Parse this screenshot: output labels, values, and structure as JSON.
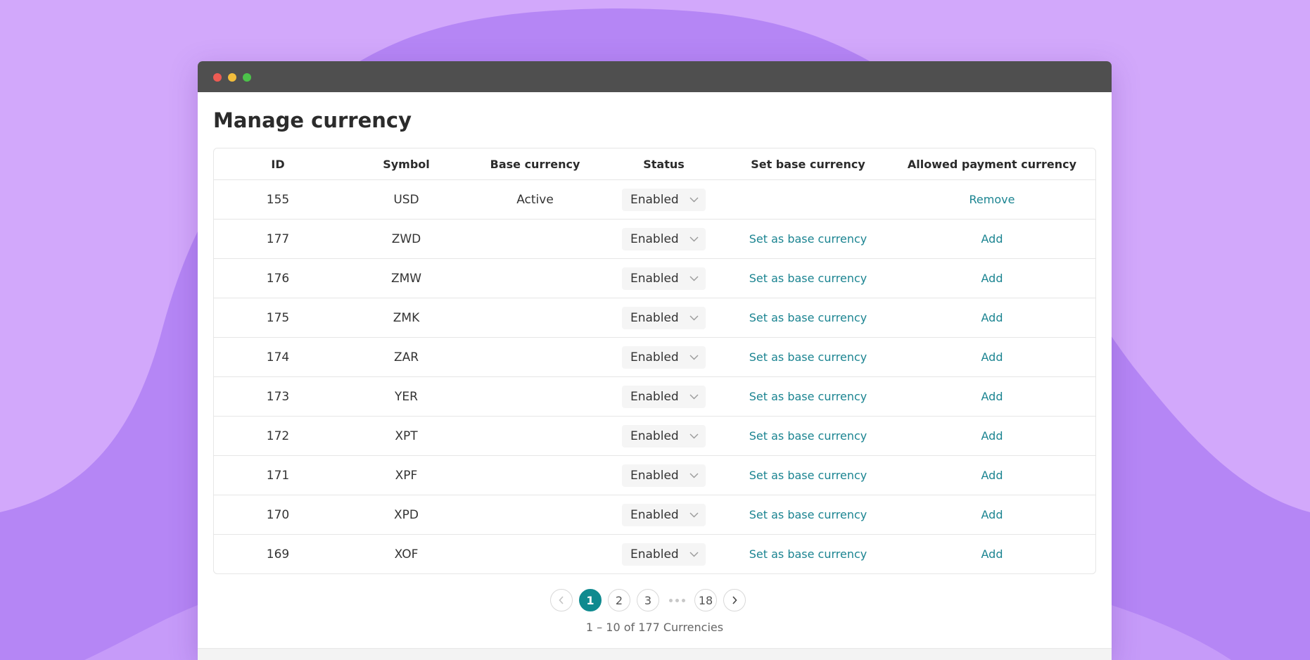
{
  "window": {
    "title_dots": [
      "close",
      "minimize",
      "maximize"
    ]
  },
  "page": {
    "title": "Manage currency"
  },
  "table": {
    "headers": {
      "id": "ID",
      "symbol": "Symbol",
      "base": "Base currency",
      "status": "Status",
      "set_base": "Set base currency",
      "allowed": "Allowed payment currency"
    },
    "rows": [
      {
        "id": "155",
        "symbol": "USD",
        "base": "Active",
        "status": "Enabled",
        "set_base": "",
        "allowed": "Remove"
      },
      {
        "id": "177",
        "symbol": "ZWD",
        "base": "",
        "status": "Enabled",
        "set_base": "Set as base currency",
        "allowed": "Add"
      },
      {
        "id": "176",
        "symbol": "ZMW",
        "base": "",
        "status": "Enabled",
        "set_base": "Set as base currency",
        "allowed": "Add"
      },
      {
        "id": "175",
        "symbol": "ZMK",
        "base": "",
        "status": "Enabled",
        "set_base": "Set as base currency",
        "allowed": "Add"
      },
      {
        "id": "174",
        "symbol": "ZAR",
        "base": "",
        "status": "Enabled",
        "set_base": "Set as base currency",
        "allowed": "Add"
      },
      {
        "id": "173",
        "symbol": "YER",
        "base": "",
        "status": "Enabled",
        "set_base": "Set as base currency",
        "allowed": "Add"
      },
      {
        "id": "172",
        "symbol": "XPT",
        "base": "",
        "status": "Enabled",
        "set_base": "Set as base currency",
        "allowed": "Add"
      },
      {
        "id": "171",
        "symbol": "XPF",
        "base": "",
        "status": "Enabled",
        "set_base": "Set as base currency",
        "allowed": "Add"
      },
      {
        "id": "170",
        "symbol": "XPD",
        "base": "",
        "status": "Enabled",
        "set_base": "Set as base currency",
        "allowed": "Add"
      },
      {
        "id": "169",
        "symbol": "XOF",
        "base": "",
        "status": "Enabled",
        "set_base": "Set as base currency",
        "allowed": "Add"
      }
    ]
  },
  "pagination": {
    "pages": [
      "1",
      "2",
      "3"
    ],
    "last_page": "18",
    "active_page": "1",
    "summary": "1 – 10 of 177 Currencies"
  },
  "icons": {
    "prev": "chevron-left-icon",
    "next": "chevron-right-icon",
    "dropdown": "chevron-down-icon",
    "ellipsis": "ellipsis-icon"
  },
  "colors": {
    "background": "#d2a8fb",
    "background_shape": "#b586f5",
    "titlebar": "#4f4f4f",
    "accent": "#0f8a8f",
    "link": "#1b8491"
  }
}
